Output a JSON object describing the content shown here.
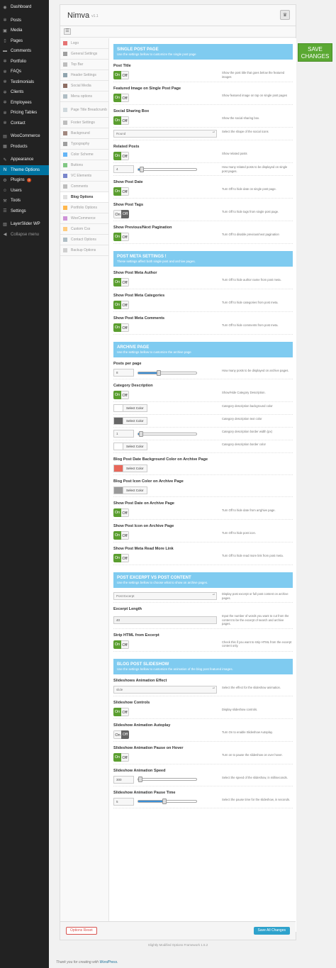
{
  "wp_menu": [
    {
      "label": "Dashboard",
      "icon": "dashboard-icon",
      "glyph": "◉"
    },
    {
      "sep": true
    },
    {
      "label": "Posts",
      "icon": "pin-icon",
      "glyph": "✲"
    },
    {
      "label": "Media",
      "icon": "media-icon",
      "glyph": "▣"
    },
    {
      "label": "Pages",
      "icon": "pages-icon",
      "glyph": "▯"
    },
    {
      "label": "Comments",
      "icon": "comments-icon",
      "glyph": "▬"
    },
    {
      "label": "Portfolio",
      "icon": "pin-icon",
      "glyph": "✲"
    },
    {
      "label": "FAQs",
      "icon": "pin-icon",
      "glyph": "✲"
    },
    {
      "label": "Testimonials",
      "icon": "pin-icon",
      "glyph": "✲"
    },
    {
      "label": "Clients",
      "icon": "pin-icon",
      "glyph": "✲"
    },
    {
      "label": "Employees",
      "icon": "pin-icon",
      "glyph": "✲"
    },
    {
      "label": "Pricing Tables",
      "icon": "pin-icon",
      "glyph": "✲"
    },
    {
      "label": "Contact",
      "icon": "pin-icon",
      "glyph": "✲"
    },
    {
      "sep": true
    },
    {
      "label": "WooCommerce",
      "icon": "woocommerce-icon",
      "glyph": "▤"
    },
    {
      "label": "Products",
      "icon": "products-icon",
      "glyph": "▦"
    },
    {
      "sep": true
    },
    {
      "label": "Appearance",
      "icon": "appearance-icon",
      "glyph": "✎"
    },
    {
      "label": "Theme Options",
      "icon": "theme-options-icon",
      "glyph": "N",
      "current": true
    },
    {
      "label": "Plugins",
      "icon": "plugins-icon",
      "glyph": "⚙",
      "badge": "3"
    },
    {
      "label": "Users",
      "icon": "users-icon",
      "glyph": "☺"
    },
    {
      "label": "Tools",
      "icon": "tools-icon",
      "glyph": "⚒"
    },
    {
      "label": "Settings",
      "icon": "settings-icon",
      "glyph": "☰"
    },
    {
      "sep": true
    },
    {
      "label": "LayerSlider WP",
      "icon": "layerslider-icon",
      "glyph": "▧"
    },
    {
      "label": "Collapse menu",
      "icon": "collapse-icon",
      "glyph": "◀",
      "collapse": true
    }
  ],
  "panel": {
    "title": "Nimva",
    "version": "v1.1"
  },
  "options_nav": [
    {
      "label": "Logo",
      "icon": "logo-icon",
      "color": "#e57373"
    },
    {
      "label": "General Settings",
      "icon": "general-settings-icon",
      "color": "#9e9e9e"
    },
    {
      "label": "Top Bar",
      "icon": "top-bar-icon",
      "color": "#bdbdbd"
    },
    {
      "label": "Header Settings",
      "icon": "header-settings-icon",
      "color": "#90a4ae"
    },
    {
      "label": "Social Media",
      "icon": "social-media-icon",
      "color": "#8d6e63"
    },
    {
      "label": "Menu options",
      "icon": "menu-options-icon",
      "color": "#b0bec5"
    },
    {
      "label": "Page Title Breadcrumb",
      "icon": "page-title-icon",
      "color": "#cfd8dc",
      "two": true
    },
    {
      "label": "Footer Settings",
      "icon": "footer-settings-icon",
      "color": "#bdbdbd"
    },
    {
      "label": "Background",
      "icon": "background-icon",
      "color": "#a1887f"
    },
    {
      "label": "Typography",
      "icon": "typography-icon",
      "color": "#9e9e9e"
    },
    {
      "label": "Color Scheme",
      "icon": "color-scheme-icon",
      "color": "#64b5f6"
    },
    {
      "label": "Buttons",
      "icon": "buttons-icon",
      "color": "#81c784"
    },
    {
      "label": "VC Elements",
      "icon": "vc-elements-icon",
      "color": "#7986cb"
    },
    {
      "label": "Comments",
      "icon": "comments-icon",
      "color": "#bdbdbd"
    },
    {
      "label": "Blog Options",
      "icon": "blog-options-icon",
      "color": "#e0e0e0",
      "active": true
    },
    {
      "label": "Portfolio Options",
      "icon": "portfolio-options-icon",
      "color": "#ffb74d"
    },
    {
      "label": "WooCommerce",
      "icon": "woocommerce-icon",
      "color": "#ce93d8"
    },
    {
      "label": "Custom Css",
      "icon": "custom-css-icon",
      "color": "#ffcc80"
    },
    {
      "label": "Contact Options",
      "icon": "contact-options-icon",
      "color": "#b0bec5"
    },
    {
      "label": "Backup Options",
      "icon": "backup-options-icon",
      "color": "#cfcfcf"
    }
  ],
  "sections": [
    {
      "type": "heading",
      "title": "SINGLE POST PAGE",
      "subtitle": "Use the settings bellow to customize the single post page"
    },
    {
      "type": "toggle",
      "label": "Post Title",
      "value": "on",
      "on": "On",
      "off": "Off",
      "desc": "Show the post title that goes below the featured images"
    },
    {
      "type": "toggle",
      "label": "Featured Image on Single Post Page",
      "value": "on",
      "on": "On",
      "off": "Off",
      "desc": "Show featured image on top on single post pages"
    },
    {
      "type": "toggle",
      "label": "Social Sharing Box",
      "value": "on",
      "on": "On",
      "off": "Off",
      "desc": "Show the social sharing box."
    },
    {
      "type": "select",
      "value": "Round",
      "desc": "Select the shape of the social icons"
    },
    {
      "type": "toggle",
      "label": "Related Posts",
      "value": "on",
      "on": "On",
      "off": "Off",
      "desc": "Show related posts"
    },
    {
      "type": "slider",
      "value": "4",
      "fraction": 0.06,
      "desc": "How many related posts to be displayed on single post pages."
    },
    {
      "type": "toggle",
      "label": "Show Post Date",
      "value": "on",
      "on": "On",
      "off": "Off",
      "desc": "Turn Off to hide date on single post page."
    },
    {
      "type": "toggle",
      "label": "Show Post Tags",
      "value": "off",
      "on": "On",
      "off": "Off",
      "desc": "Turn Off to hide tags from single post page."
    },
    {
      "type": "toggle",
      "label": "Show Previous/Next Pagination",
      "value": "on",
      "on": "On",
      "off": "Off",
      "desc": "Turn Off to disable previous/next pagination"
    },
    {
      "type": "heading",
      "title": "POST META SETTINGS !",
      "subtitle": "These settings affect both single post and archive pages."
    },
    {
      "type": "toggle",
      "label": "Show Post Meta Author",
      "value": "on",
      "on": "On",
      "off": "Off",
      "desc": "Turn Off to hide author name from post meta."
    },
    {
      "type": "toggle",
      "label": "Show Post Meta Categories",
      "value": "on",
      "on": "On",
      "off": "Off",
      "desc": "Turn Off to hide categories from post meta."
    },
    {
      "type": "toggle",
      "label": "Show Post Meta Comments",
      "value": "on",
      "on": "On",
      "off": "Off",
      "desc": "Turn Off to hide comments from post meta."
    },
    {
      "type": "heading",
      "title": "ARCHIVE PAGE",
      "subtitle": "Use the settings bellow to customize the archive page"
    },
    {
      "type": "slider",
      "label": "Posts per page",
      "value": "8",
      "fraction": 0.35,
      "desc": "How many posts to be displayed on archive pages."
    },
    {
      "type": "toggle",
      "label": "Category Description",
      "value": "on",
      "on": "On",
      "off": "Off",
      "desc": "Show/Hide Category Description."
    },
    {
      "type": "color",
      "value": "#ffffff",
      "button": "Select Color",
      "desc": "Category description background color"
    },
    {
      "type": "color",
      "value": "#666666",
      "button": "Select Color",
      "desc": "Category description text color"
    },
    {
      "type": "slider",
      "value": "1",
      "fraction": 0.05,
      "desc": "Category description border width (px)"
    },
    {
      "type": "color",
      "value": "#ffffff",
      "button": "Select Color",
      "desc": "Category description border color"
    },
    {
      "type": "color",
      "label": "Blog Post Date Background Color on Archive Page",
      "value": "#e8675a",
      "button": "Select Color",
      "desc": ""
    },
    {
      "type": "color",
      "label": "Blog Post Icon Color on Archive Page",
      "value": "#9a9a9a",
      "button": "Select Color",
      "desc": ""
    },
    {
      "type": "toggle",
      "label": "Show Post Date on Archive Page",
      "value": "on",
      "on": "On",
      "off": "Off",
      "desc": "Turn Off to hide date from arrghive page."
    },
    {
      "type": "toggle",
      "label": "Show Post Icon on Archive Page",
      "value": "on",
      "on": "On",
      "off": "Off",
      "desc": "Turn Off to hide post icon."
    },
    {
      "type": "toggle",
      "label": "Show Post Meta Read More Link",
      "value": "on",
      "on": "On",
      "off": "Off",
      "desc": "Turn Off to hide read more link from post meta."
    },
    {
      "type": "heading",
      "title": "POST EXCERPT VS POST CONTENT",
      "subtitle": "Use the settings bellow to choose what to show on archive pages."
    },
    {
      "type": "select",
      "value": "Post Excerpt",
      "desc": "Display post excerpt or full post content on archive pages."
    },
    {
      "type": "text",
      "label": "Excerpt Length",
      "value": "40",
      "desc": "Input the number of words you want to cut from the content to be the excerpt of search and archive pages."
    },
    {
      "type": "toggle",
      "label": "Strip HTML from Excerpt",
      "value": "on",
      "on": "On",
      "off": "Off",
      "desc": "Check this if you want to strip HTML from the excerpt content only."
    },
    {
      "type": "heading",
      "title": "BLOG POST SLIDESHOW",
      "subtitle": "Use the settings bellow to customize the animation of the blog post featured images."
    },
    {
      "type": "select",
      "label": "Slideshows Animation Effect",
      "value": "slide",
      "desc": "Select the effect for the slideshow animation."
    },
    {
      "type": "toggle",
      "label": "Slideshow Controls",
      "value": "on",
      "on": "On",
      "off": "Off",
      "desc": "Display slideshow controls."
    },
    {
      "type": "toggle",
      "label": "Slideshow Animation Autoplay",
      "value": "off",
      "on": "On",
      "off": "Off",
      "desc": "Turn On to enable Slideshow Autoplay."
    },
    {
      "type": "toggle",
      "label": "Slideshow Animation Pause on Hover",
      "value": "on",
      "on": "On",
      "off": "Off",
      "desc": "Turn on to pause the slideshow on over hover."
    },
    {
      "type": "slider",
      "label": "Slideshow Animation Speed",
      "value": "300",
      "fraction": 0.04,
      "desc": "Select the speed of the slideshow, in milliseconds."
    },
    {
      "type": "slider",
      "label": "Slideshow Animation Pause Time",
      "value": "5",
      "fraction": 0.45,
      "desc": "Select the pause time for the slideshow, in seconds."
    }
  ],
  "footer": {
    "reset": "Options Reset",
    "save": "Save All Changes"
  },
  "framework_note": "Slightly Modified Options Framework 1.5.2",
  "thanks_prefix": "Thank you for creating with ",
  "thanks_link": "WordPress.",
  "float_save": "SAVE CHANGES",
  "colors": {
    "accent": "#0074a2",
    "on": "#5a9e2f",
    "heading": "#7fcbf0",
    "save_float": "#5aa832"
  }
}
